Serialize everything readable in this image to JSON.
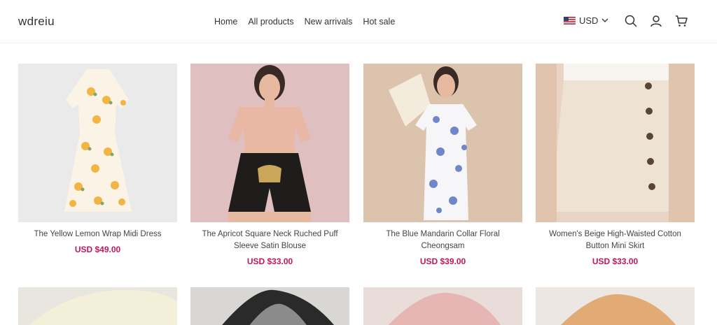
{
  "header": {
    "logo": "wdreiu",
    "nav": [
      "Home",
      "All products",
      "New arrivals",
      "Hot sale"
    ],
    "currency": "USD",
    "icons": [
      "search-icon",
      "user-icon",
      "cart-icon"
    ]
  },
  "products": [
    {
      "title": "The Yellow Lemon Wrap Midi Dress",
      "price": "USD $49.00"
    },
    {
      "title": "The Apricot Square Neck Ruched Puff Sleeve Satin Blouse",
      "price": "USD $33.00"
    },
    {
      "title": "The Blue Mandarin Collar Floral Cheongsam",
      "price": "USD $39.00"
    },
    {
      "title": "Women's Beige High-Waisted Cotton Button Mini Skirt",
      "price": "USD $33.00"
    }
  ],
  "colors": {
    "price": "#c2185b"
  }
}
